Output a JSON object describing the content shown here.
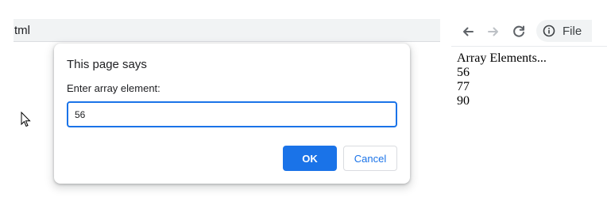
{
  "browser_left": {
    "url_fragment": "tml"
  },
  "browser_right": {
    "toolbar": {
      "back_icon": "arrow-left",
      "forward_icon": "arrow-right",
      "reload_icon": "reload",
      "site_info_icon": "info-circle",
      "site_chip_label": "File"
    },
    "page": {
      "heading": "Array Elements...",
      "elements": [
        "56",
        "77",
        "90"
      ]
    }
  },
  "dialog": {
    "title": "This page says",
    "message": "Enter array element:",
    "input_value": "56",
    "ok_label": "OK",
    "cancel_label": "Cancel"
  },
  "colors": {
    "accent": "#1a73e8",
    "toolbar_bg": "#f1f3f4",
    "text": "#202124"
  }
}
